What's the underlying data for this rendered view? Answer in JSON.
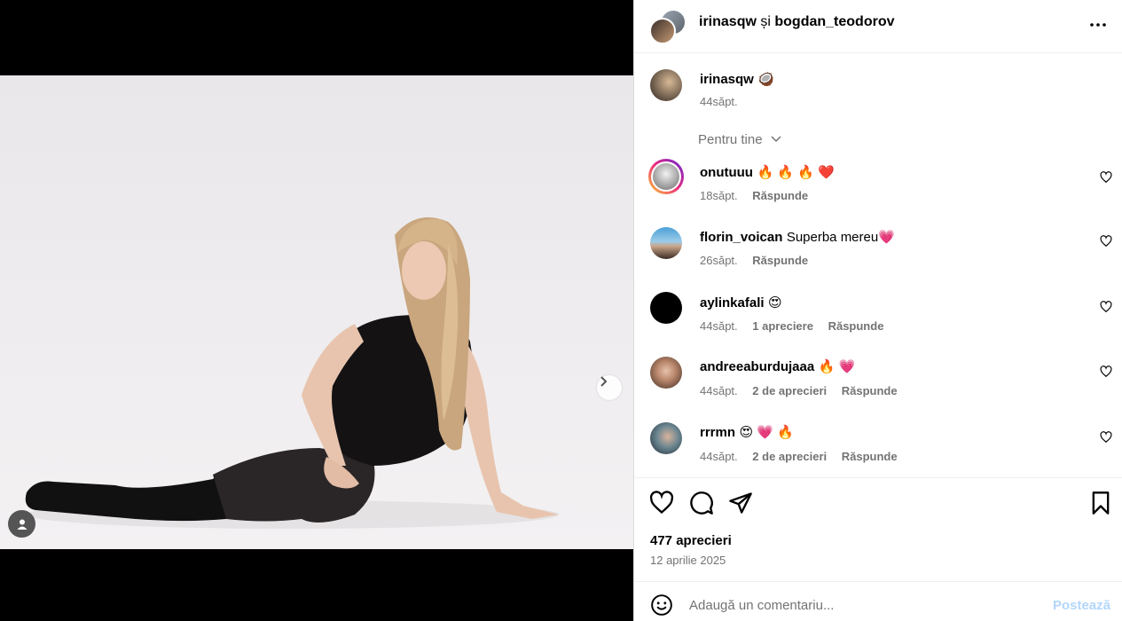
{
  "post": {
    "header": {
      "user1": "irinasqw",
      "conj": "și",
      "user2": "bogdan_teodorov"
    },
    "caption": {
      "username": "irinasqw",
      "emoji": "🥥",
      "time": "44săpt."
    },
    "sort_label": "Pentru tine",
    "comments": [
      {
        "username": "onutuuu",
        "text": "🔥 🔥 🔥 ❤️",
        "time": "18săpt.",
        "likes": "",
        "reply": "Răspunde"
      },
      {
        "username": "florin_voican",
        "text": "Superba mereu💗",
        "time": "26săpt.",
        "likes": "",
        "reply": "Răspunde"
      },
      {
        "username": "aylinkafali",
        "text": "😍",
        "time": "44săpt.",
        "likes": "1 apreciere",
        "reply": "Răspunde"
      },
      {
        "username": "andreeaburdujaaa",
        "text": "🔥 💗",
        "time": "44săpt.",
        "likes": "2 de aprecieri",
        "reply": "Răspunde"
      },
      {
        "username": "rrrmn",
        "text": "😍 💗 🔥",
        "time": "44săpt.",
        "likes": "2 de aprecieri",
        "reply": "Răspunde"
      }
    ],
    "likes_count": "477 aprecieri",
    "date": "12 aprilie 2025",
    "composer": {
      "placeholder": "Adaugă un comentariu...",
      "post_label": "Postează"
    }
  },
  "icons": {
    "more": "more-horizontal-icon",
    "like": "heart-icon",
    "comment": "comment-icon",
    "share": "share-icon",
    "save": "bookmark-icon",
    "emoji": "emoji-icon",
    "next": "chevron-right-icon",
    "tag": "user-tag-icon"
  },
  "colors": {
    "accent": "#0095f6",
    "muted": "#737373",
    "post_disabled": "#b3d6fb"
  }
}
